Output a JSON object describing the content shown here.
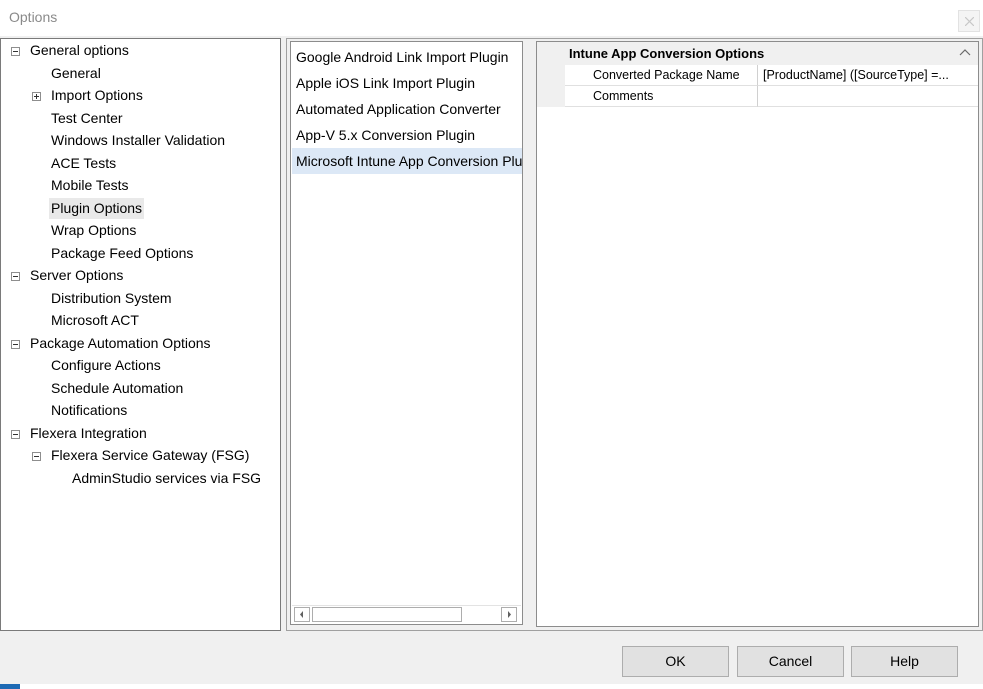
{
  "window": {
    "title": "Options"
  },
  "tree": {
    "items": [
      {
        "label": "General options",
        "expander": "minus"
      },
      {
        "label": "General"
      },
      {
        "label": "Import Options",
        "expander": "plus"
      },
      {
        "label": "Test Center"
      },
      {
        "label": "Windows Installer Validation"
      },
      {
        "label": "ACE Tests"
      },
      {
        "label": "Mobile Tests"
      },
      {
        "label": "Plugin Options",
        "selected": true
      },
      {
        "label": "Wrap Options"
      },
      {
        "label": "Package Feed Options"
      },
      {
        "label": "Server Options",
        "expander": "minus"
      },
      {
        "label": "Distribution System"
      },
      {
        "label": "Microsoft ACT"
      },
      {
        "label": "Package Automation Options",
        "expander": "minus"
      },
      {
        "label": "Configure Actions"
      },
      {
        "label": "Schedule Automation"
      },
      {
        "label": "Notifications"
      },
      {
        "label": "Flexera Integration",
        "expander": "minus"
      },
      {
        "label": "Flexera Service Gateway (FSG)",
        "expander": "minus"
      },
      {
        "label": "AdminStudio services via FSG"
      }
    ]
  },
  "plugins": {
    "items": [
      {
        "label": "Google Android Link Import Plugin"
      },
      {
        "label": "Apple iOS Link Import Plugin"
      },
      {
        "label": "Automated Application Converter"
      },
      {
        "label": "App-V 5.x Conversion Plugin"
      },
      {
        "label": "Microsoft Intune App Conversion Plugin",
        "selected": true
      }
    ]
  },
  "properties": {
    "category": "Intune App Conversion Options",
    "rows": [
      {
        "name": "Converted Package Name",
        "value": "[ProductName] ([SourceType] =..."
      },
      {
        "name": "Comments",
        "value": ""
      }
    ]
  },
  "buttons": {
    "ok": "OK",
    "cancel": "Cancel",
    "help": "Help"
  },
  "colors": {
    "selection_tree": "#e9e9e9",
    "selection_list": "#dce8f6",
    "accent": "#1e6ab4"
  }
}
